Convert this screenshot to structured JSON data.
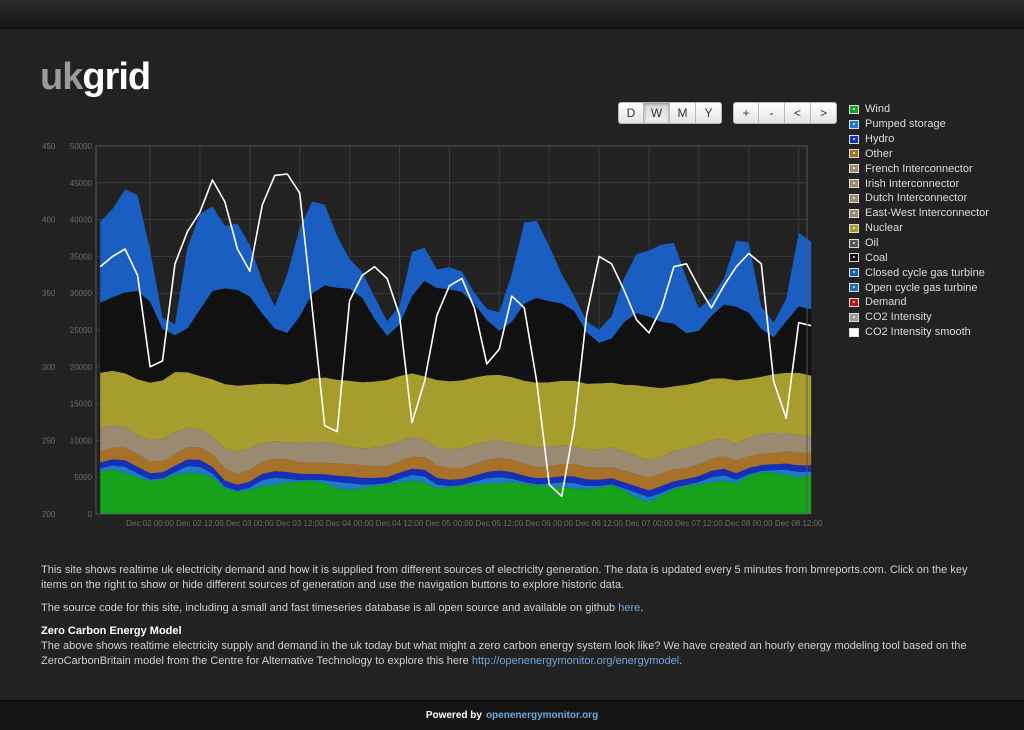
{
  "app": {
    "logo_uk": "uk",
    "logo_grid": "grid"
  },
  "toolbar": {
    "range_buttons": [
      {
        "label": "D",
        "active": false
      },
      {
        "label": "W",
        "active": true
      },
      {
        "label": "M",
        "active": false
      },
      {
        "label": "Y",
        "active": false
      }
    ],
    "nav_buttons": [
      {
        "label": "+"
      },
      {
        "label": "-"
      },
      {
        "label": "<"
      },
      {
        "label": ">"
      }
    ]
  },
  "legend": {
    "items": [
      {
        "label": "Wind",
        "color": "#16a21a"
      },
      {
        "label": "Pumped storage",
        "color": "#1e7bc9"
      },
      {
        "label": "Hydro",
        "color": "#1530b8"
      },
      {
        "label": "Other",
        "color": "#a7712a"
      },
      {
        "label": "French Interconnector",
        "color": "#9a8a72"
      },
      {
        "label": "Irish Interconnector",
        "color": "#9a8a72"
      },
      {
        "label": "Dutch Interconnector",
        "color": "#9a8a72"
      },
      {
        "label": "East-West Interconnector",
        "color": "#9a8a72"
      },
      {
        "label": "Nuclear",
        "color": "#a79c2e"
      },
      {
        "label": "Oil",
        "color": "#555555"
      },
      {
        "label": "Coal",
        "color": "#111111"
      },
      {
        "label": "Closed cycle gas turbine",
        "color": "#1a5ec2"
      },
      {
        "label": "Open cycle gas turbine",
        "color": "#2567b0"
      },
      {
        "label": "Demand",
        "color": "#c21414"
      },
      {
        "label": "CO2 Intensity",
        "color": "#9a9a9a"
      },
      {
        "label": "CO2 Intensity smooth",
        "color": "#ffffff"
      }
    ]
  },
  "chart_data": {
    "type": "area",
    "stacked": true,
    "x_ticks": [
      "Dec 02 00:00",
      "Dec 02 12:00",
      "Dec 03 00:00",
      "Dec 03 12:00",
      "Dec 04 00:00",
      "Dec 04 12:00",
      "Dec 05 00:00",
      "Dec 05 12:00",
      "Dec 06 00:00",
      "Dec 06 12:00",
      "Dec 07 00:00",
      "Dec 07 12:00",
      "Dec 08 00:00",
      "Dec 08 12:00"
    ],
    "x": [
      0,
      3,
      6,
      9,
      12,
      15,
      18,
      21,
      24,
      27,
      30,
      33,
      36,
      39,
      42,
      45,
      48,
      51,
      54,
      57,
      60,
      63,
      66,
      69,
      72,
      75,
      78,
      81,
      84,
      87,
      90,
      93,
      96,
      99,
      102,
      105,
      108,
      111,
      114,
      117,
      120,
      123,
      126,
      129,
      132,
      135,
      138,
      141,
      144,
      147,
      150,
      153,
      156,
      159,
      162,
      165,
      168,
      171
    ],
    "x_unit": "hours",
    "yleft": {
      "ticks": [
        0,
        5000,
        10000,
        15000,
        20000,
        25000,
        30000,
        35000,
        40000,
        45000,
        50000
      ],
      "ylim": [
        0,
        50000
      ]
    },
    "yright": {
      "ticks": [
        200,
        250,
        300,
        350,
        400,
        450
      ],
      "ylim": [
        200,
        450
      ]
    },
    "series": [
      {
        "name": "Wind",
        "color": "#16a21a",
        "values": [
          5800,
          6000,
          5600,
          5000,
          4500,
          4700,
          5300,
          5600,
          5500,
          5000,
          3500,
          3000,
          3200,
          3800,
          4000,
          4300,
          4400,
          4500,
          4200,
          3500,
          3300,
          3500,
          3800,
          4000,
          4300,
          4500,
          4300,
          3500,
          3600,
          3800,
          4000,
          4100,
          4200,
          4300,
          4100,
          3900,
          3800,
          3600,
          3500,
          3400,
          3600,
          3900,
          3200,
          2200,
          1600,
          2500,
          3400,
          3800,
          4000,
          4300,
          4500,
          4200,
          5200,
          5700,
          5600,
          5300,
          5000,
          5300
        ]
      },
      {
        "name": "Pumped storage",
        "color": "#1e7bc9",
        "values": [
          400,
          600,
          800,
          500,
          200,
          150,
          400,
          900,
          900,
          500,
          200,
          150,
          400,
          800,
          900,
          500,
          200,
          150,
          400,
          850,
          900,
          500,
          250,
          200,
          500,
          800,
          800,
          500,
          200,
          150,
          400,
          750,
          800,
          500,
          250,
          150,
          350,
          700,
          700,
          400,
          200,
          150,
          300,
          700,
          700,
          400,
          200,
          150,
          350,
          700,
          750,
          450,
          200,
          150,
          350,
          700,
          700,
          400
        ]
      },
      {
        "name": "Hydro",
        "color": "#1530b8",
        "values": [
          800,
          850,
          900,
          900,
          850,
          800,
          850,
          900,
          950,
          900,
          850,
          800,
          800,
          850,
          900,
          900,
          850,
          800,
          800,
          850,
          900,
          900,
          850,
          800,
          800,
          850,
          900,
          900,
          850,
          800,
          800,
          850,
          900,
          900,
          850,
          800,
          800,
          850,
          900,
          900,
          850,
          800,
          800,
          850,
          900,
          900,
          850,
          800,
          800,
          850,
          900,
          900,
          850,
          800,
          800,
          850,
          900,
          900
        ]
      },
      {
        "name": "Other",
        "color": "#a7712a",
        "values": [
          1500,
          1600,
          1700,
          1700,
          1600,
          1500,
          1550,
          1650,
          1700,
          1700,
          1600,
          1500,
          1550,
          1650,
          1700,
          1700,
          1600,
          1500,
          1550,
          1650,
          1700,
          1700,
          1600,
          1500,
          1550,
          1650,
          1700,
          1700,
          1600,
          1500,
          1550,
          1650,
          1700,
          1700,
          1600,
          1500,
          1550,
          1650,
          1700,
          1700,
          1600,
          1500,
          1550,
          1650,
          1700,
          1700,
          1600,
          1500,
          1550,
          1650,
          1700,
          1700,
          1600,
          1500,
          1550,
          1650,
          1700,
          1700
        ]
      },
      {
        "name": "Interconnectors",
        "color": "#9a8a72",
        "values": [
          3200,
          3000,
          2800,
          2600,
          2900,
          3000,
          3000,
          2700,
          2500,
          2400,
          2700,
          3000,
          3000,
          2600,
          2400,
          2300,
          2600,
          2900,
          2900,
          2600,
          2400,
          2300,
          2500,
          2800,
          2800,
          2600,
          2500,
          2400,
          2500,
          2700,
          2700,
          2500,
          2400,
          2300,
          2500,
          2700,
          2700,
          2500,
          2400,
          2300,
          2500,
          2700,
          2700,
          2500,
          2400,
          2300,
          2500,
          2700,
          2700,
          2500,
          2400,
          2300,
          2500,
          2700,
          2700,
          2500,
          2400,
          2300
        ]
      },
      {
        "name": "Nuclear",
        "color": "#a79c2e",
        "values": [
          7500,
          7400,
          7300,
          7600,
          7800,
          8000,
          8200,
          7500,
          7200,
          7800,
          8800,
          9000,
          8600,
          8000,
          7800,
          7900,
          8200,
          8600,
          8700,
          8800,
          8900,
          9000,
          9000,
          8900,
          8800,
          8700,
          8500,
          9200,
          9300,
          9200,
          9100,
          9000,
          8900,
          8900,
          8800,
          8800,
          8700,
          8800,
          8900,
          9000,
          9000,
          8800,
          9000,
          9600,
          10000,
          9300,
          8800,
          8600,
          8500,
          8400,
          8200,
          8600,
          8000,
          7800,
          8000,
          8200,
          8500,
          8200
        ]
      },
      {
        "name": "Coal",
        "color": "#111111",
        "values": [
          9500,
          10000,
          11000,
          12000,
          11000,
          7000,
          5000,
          6000,
          9000,
          12000,
          13000,
          13000,
          12000,
          9500,
          7500,
          7000,
          9000,
          11500,
          12500,
          12500,
          12500,
          11500,
          8500,
          6000,
          7000,
          10500,
          13000,
          12500,
          12500,
          12000,
          10000,
          7500,
          6000,
          7500,
          10500,
          11500,
          11000,
          10500,
          9500,
          7000,
          5500,
          6000,
          8500,
          9800,
          9500,
          9000,
          8500,
          7000,
          7000,
          8500,
          10000,
          10000,
          9000,
          6500,
          5000,
          7000,
          9000,
          9000
        ]
      },
      {
        "name": "Closed cycle gas turbine",
        "color": "#1a5ec2",
        "values": [
          11000,
          12000,
          14000,
          13000,
          7000,
          1500,
          1500,
          11000,
          13000,
          11500,
          8500,
          9000,
          7000,
          4500,
          3000,
          8000,
          12000,
          12500,
          11000,
          7000,
          4000,
          3500,
          3000,
          2000,
          2500,
          6000,
          4500,
          2500,
          3000,
          2800,
          1500,
          1500,
          2500,
          6500,
          11000,
          10500,
          7500,
          4000,
          2000,
          1500,
          1800,
          3000,
          6000,
          8000,
          9000,
          10500,
          11000,
          7500,
          3000,
          2500,
          3500,
          9000,
          9500,
          3000,
          2000,
          3000,
          10000,
          9200
        ]
      },
      {
        "name": "Open cycle gas turbine",
        "color": "#2567b0",
        "values": [
          0,
          0,
          0,
          0,
          0,
          0,
          0,
          0,
          0,
          0,
          0,
          0,
          0,
          0,
          0,
          0,
          0,
          0,
          0,
          0,
          0,
          0,
          0,
          0,
          0,
          0,
          0,
          0,
          0,
          0,
          0,
          0,
          0,
          0,
          0,
          0,
          0,
          0,
          0,
          0,
          0,
          0,
          0,
          0,
          0,
          0,
          0,
          0,
          0,
          0,
          0,
          0,
          0,
          0,
          0,
          0,
          0,
          0
        ]
      },
      {
        "name": "CO2 Intensity smooth",
        "axis": "right",
        "line": true,
        "color": "#ffffff",
        "values": [
          368,
          375,
          380,
          362,
          300,
          304,
          370,
          392,
          405,
          427,
          412,
          380,
          365,
          410,
          430,
          431,
          418,
          340,
          260,
          256,
          345,
          362,
          368,
          360,
          335,
          262,
          290,
          335,
          355,
          360,
          340,
          302,
          312,
          348,
          340,
          290,
          220,
          212,
          260,
          335,
          375,
          370,
          352,
          332,
          323,
          340,
          368,
          370,
          354,
          340,
          355,
          368,
          377,
          370,
          290,
          265,
          330,
          328
        ]
      }
    ]
  },
  "content": {
    "para1": "This site shows realtime uk electricity demand and how it is supplied from different sources of electricity generation. The data is updated every 5 minutes from bmreports.com. Click on the key items on the right to show or hide different sources of generation and use the navigation buttons to explore historic data.",
    "para2_text": "The source code for this site, including a small and fast timeseries database is all open source and available on github ",
    "para2_link": "here",
    "para2_end": ".",
    "heading": "Zero Carbon Energy Model",
    "para3_text": "The above shows realtime electricity supply and demand in the uk today but what might a zero carbon energy system look like? We have created an hourly energy modeling tool based on the ZeroCarbonBritain model from the Centre for Alternative Technology to explore this here ",
    "para3_link": "http://openenergymonitor.org/energymodel",
    "para3_end": "."
  },
  "footer": {
    "powered_by": "Powered by",
    "link": "openenergymonitor.org"
  }
}
